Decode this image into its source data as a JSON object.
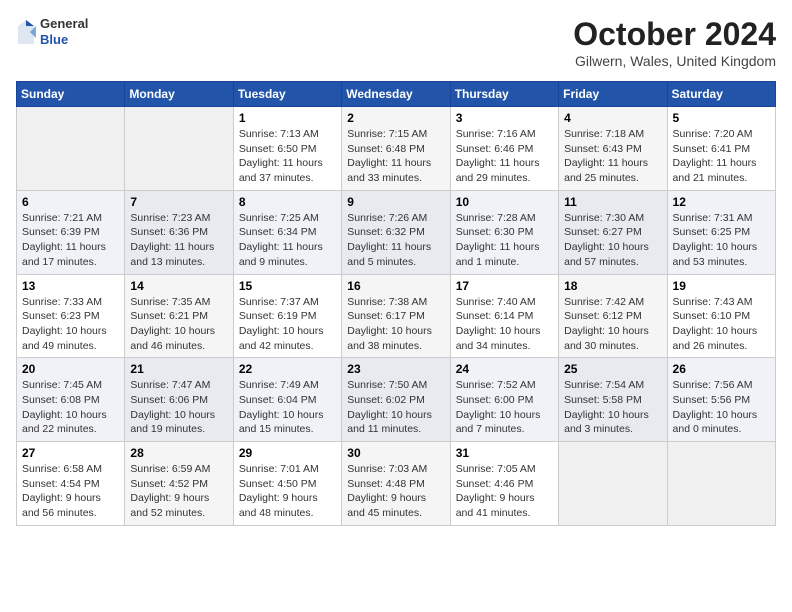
{
  "header": {
    "logo": {
      "general": "General",
      "blue": "Blue"
    },
    "title": "October 2024",
    "location": "Gilwern, Wales, United Kingdom"
  },
  "days_of_week": [
    "Sunday",
    "Monday",
    "Tuesday",
    "Wednesday",
    "Thursday",
    "Friday",
    "Saturday"
  ],
  "weeks": [
    [
      {
        "day": "",
        "sunrise": "",
        "sunset": "",
        "daylight": ""
      },
      {
        "day": "",
        "sunrise": "",
        "sunset": "",
        "daylight": ""
      },
      {
        "day": "1",
        "sunrise": "Sunrise: 7:13 AM",
        "sunset": "Sunset: 6:50 PM",
        "daylight": "Daylight: 11 hours and 37 minutes."
      },
      {
        "day": "2",
        "sunrise": "Sunrise: 7:15 AM",
        "sunset": "Sunset: 6:48 PM",
        "daylight": "Daylight: 11 hours and 33 minutes."
      },
      {
        "day": "3",
        "sunrise": "Sunrise: 7:16 AM",
        "sunset": "Sunset: 6:46 PM",
        "daylight": "Daylight: 11 hours and 29 minutes."
      },
      {
        "day": "4",
        "sunrise": "Sunrise: 7:18 AM",
        "sunset": "Sunset: 6:43 PM",
        "daylight": "Daylight: 11 hours and 25 minutes."
      },
      {
        "day": "5",
        "sunrise": "Sunrise: 7:20 AM",
        "sunset": "Sunset: 6:41 PM",
        "daylight": "Daylight: 11 hours and 21 minutes."
      }
    ],
    [
      {
        "day": "6",
        "sunrise": "Sunrise: 7:21 AM",
        "sunset": "Sunset: 6:39 PM",
        "daylight": "Daylight: 11 hours and 17 minutes."
      },
      {
        "day": "7",
        "sunrise": "Sunrise: 7:23 AM",
        "sunset": "Sunset: 6:36 PM",
        "daylight": "Daylight: 11 hours and 13 minutes."
      },
      {
        "day": "8",
        "sunrise": "Sunrise: 7:25 AM",
        "sunset": "Sunset: 6:34 PM",
        "daylight": "Daylight: 11 hours and 9 minutes."
      },
      {
        "day": "9",
        "sunrise": "Sunrise: 7:26 AM",
        "sunset": "Sunset: 6:32 PM",
        "daylight": "Daylight: 11 hours and 5 minutes."
      },
      {
        "day": "10",
        "sunrise": "Sunrise: 7:28 AM",
        "sunset": "Sunset: 6:30 PM",
        "daylight": "Daylight: 11 hours and 1 minute."
      },
      {
        "day": "11",
        "sunrise": "Sunrise: 7:30 AM",
        "sunset": "Sunset: 6:27 PM",
        "daylight": "Daylight: 10 hours and 57 minutes."
      },
      {
        "day": "12",
        "sunrise": "Sunrise: 7:31 AM",
        "sunset": "Sunset: 6:25 PM",
        "daylight": "Daylight: 10 hours and 53 minutes."
      }
    ],
    [
      {
        "day": "13",
        "sunrise": "Sunrise: 7:33 AM",
        "sunset": "Sunset: 6:23 PM",
        "daylight": "Daylight: 10 hours and 49 minutes."
      },
      {
        "day": "14",
        "sunrise": "Sunrise: 7:35 AM",
        "sunset": "Sunset: 6:21 PM",
        "daylight": "Daylight: 10 hours and 46 minutes."
      },
      {
        "day": "15",
        "sunrise": "Sunrise: 7:37 AM",
        "sunset": "Sunset: 6:19 PM",
        "daylight": "Daylight: 10 hours and 42 minutes."
      },
      {
        "day": "16",
        "sunrise": "Sunrise: 7:38 AM",
        "sunset": "Sunset: 6:17 PM",
        "daylight": "Daylight: 10 hours and 38 minutes."
      },
      {
        "day": "17",
        "sunrise": "Sunrise: 7:40 AM",
        "sunset": "Sunset: 6:14 PM",
        "daylight": "Daylight: 10 hours and 34 minutes."
      },
      {
        "day": "18",
        "sunrise": "Sunrise: 7:42 AM",
        "sunset": "Sunset: 6:12 PM",
        "daylight": "Daylight: 10 hours and 30 minutes."
      },
      {
        "day": "19",
        "sunrise": "Sunrise: 7:43 AM",
        "sunset": "Sunset: 6:10 PM",
        "daylight": "Daylight: 10 hours and 26 minutes."
      }
    ],
    [
      {
        "day": "20",
        "sunrise": "Sunrise: 7:45 AM",
        "sunset": "Sunset: 6:08 PM",
        "daylight": "Daylight: 10 hours and 22 minutes."
      },
      {
        "day": "21",
        "sunrise": "Sunrise: 7:47 AM",
        "sunset": "Sunset: 6:06 PM",
        "daylight": "Daylight: 10 hours and 19 minutes."
      },
      {
        "day": "22",
        "sunrise": "Sunrise: 7:49 AM",
        "sunset": "Sunset: 6:04 PM",
        "daylight": "Daylight: 10 hours and 15 minutes."
      },
      {
        "day": "23",
        "sunrise": "Sunrise: 7:50 AM",
        "sunset": "Sunset: 6:02 PM",
        "daylight": "Daylight: 10 hours and 11 minutes."
      },
      {
        "day": "24",
        "sunrise": "Sunrise: 7:52 AM",
        "sunset": "Sunset: 6:00 PM",
        "daylight": "Daylight: 10 hours and 7 minutes."
      },
      {
        "day": "25",
        "sunrise": "Sunrise: 7:54 AM",
        "sunset": "Sunset: 5:58 PM",
        "daylight": "Daylight: 10 hours and 3 minutes."
      },
      {
        "day": "26",
        "sunrise": "Sunrise: 7:56 AM",
        "sunset": "Sunset: 5:56 PM",
        "daylight": "Daylight: 10 hours and 0 minutes."
      }
    ],
    [
      {
        "day": "27",
        "sunrise": "Sunrise: 6:58 AM",
        "sunset": "Sunset: 4:54 PM",
        "daylight": "Daylight: 9 hours and 56 minutes."
      },
      {
        "day": "28",
        "sunrise": "Sunrise: 6:59 AM",
        "sunset": "Sunset: 4:52 PM",
        "daylight": "Daylight: 9 hours and 52 minutes."
      },
      {
        "day": "29",
        "sunrise": "Sunrise: 7:01 AM",
        "sunset": "Sunset: 4:50 PM",
        "daylight": "Daylight: 9 hours and 48 minutes."
      },
      {
        "day": "30",
        "sunrise": "Sunrise: 7:03 AM",
        "sunset": "Sunset: 4:48 PM",
        "daylight": "Daylight: 9 hours and 45 minutes."
      },
      {
        "day": "31",
        "sunrise": "Sunrise: 7:05 AM",
        "sunset": "Sunset: 4:46 PM",
        "daylight": "Daylight: 9 hours and 41 minutes."
      },
      {
        "day": "",
        "sunrise": "",
        "sunset": "",
        "daylight": ""
      },
      {
        "day": "",
        "sunrise": "",
        "sunset": "",
        "daylight": ""
      }
    ]
  ]
}
